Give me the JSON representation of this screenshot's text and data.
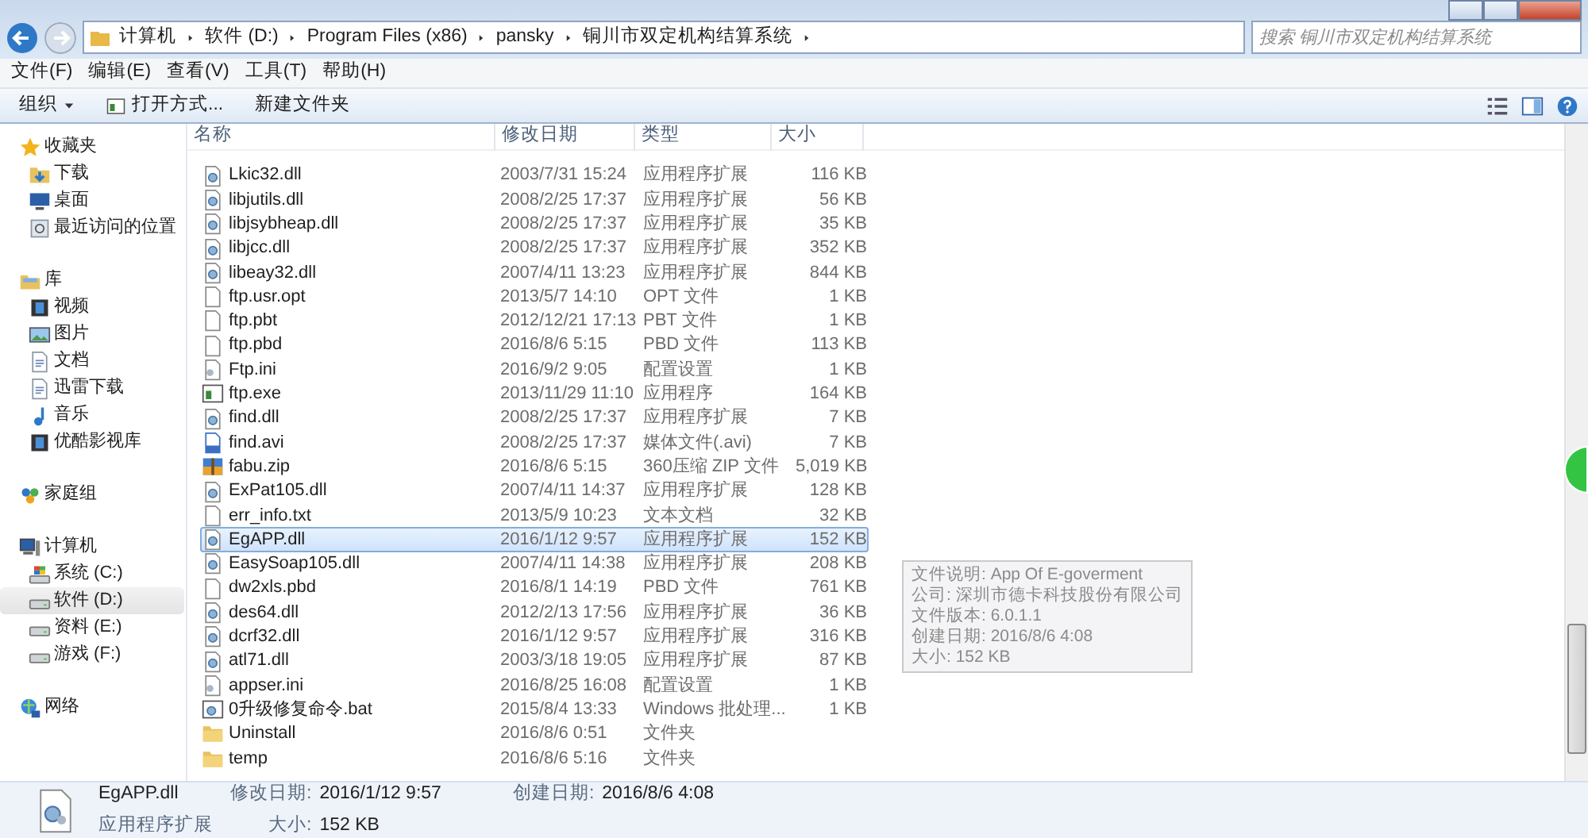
{
  "address": {
    "breadcrumb": [
      "计算机",
      "软件 (D:)",
      "Program Files (x86)",
      "pansky",
      "铜川市双定机构结算系统"
    ],
    "search": {
      "placeholder": "搜索 铜川市双定机构结算系统"
    }
  },
  "menu": [
    "文件(F)",
    "编辑(E)",
    "查看(V)",
    "工具(T)",
    "帮助(H)"
  ],
  "toolbar": [
    {
      "label": "组织",
      "kind": "menu"
    },
    {
      "label": "打开方式...",
      "kind": "open"
    },
    {
      "label": "新建文件夹",
      "kind": "plain"
    }
  ],
  "sidebar": [
    {
      "label": "收藏夹",
      "kind": "star",
      "selected": false,
      "children": [
        {
          "label": "下载",
          "kind": "download",
          "selected": false
        },
        {
          "label": "桌面",
          "kind": "desktop",
          "selected": false
        },
        {
          "label": "最近访问的位置",
          "kind": "recent",
          "selected": false
        }
      ]
    },
    {
      "label": "库",
      "kind": "library",
      "selected": false,
      "children": [
        {
          "label": "视频",
          "kind": "video",
          "selected": false
        },
        {
          "label": "图片",
          "kind": "image",
          "selected": false
        },
        {
          "label": "文档",
          "kind": "doc",
          "selected": false
        },
        {
          "label": "迅雷下载",
          "kind": "doc",
          "selected": false
        },
        {
          "label": "音乐",
          "kind": "music",
          "selected": false
        },
        {
          "label": "优酷影视库",
          "kind": "video",
          "selected": false
        }
      ]
    },
    {
      "label": "家庭组",
      "kind": "homegroup",
      "selected": false
    },
    {
      "label": "计算机",
      "kind": "computer",
      "selected": false,
      "children": [
        {
          "label": "系统 (C:)",
          "kind": "windrive",
          "selected": false
        },
        {
          "label": "软件 (D:)",
          "kind": "drive",
          "selected": true
        },
        {
          "label": "资料 (E:)",
          "kind": "drive",
          "selected": false
        },
        {
          "label": "游戏 (F:)",
          "kind": "drive",
          "selected": false
        }
      ]
    },
    {
      "label": "网络",
      "kind": "network",
      "selected": false
    }
  ],
  "columns": [
    "名称",
    "修改日期",
    "类型",
    "大小"
  ],
  "rows": [
    {
      "name": "Lkic32.dll",
      "date": "2003/7/31 15:24",
      "type": "应用程序扩展",
      "size": "116 KB",
      "kind": "dll",
      "selected": false
    },
    {
      "name": "libjutils.dll",
      "date": "2008/2/25 17:37",
      "type": "应用程序扩展",
      "size": "56 KB",
      "kind": "dll",
      "selected": false
    },
    {
      "name": "libjsybheap.dll",
      "date": "2008/2/25 17:37",
      "type": "应用程序扩展",
      "size": "35 KB",
      "kind": "dll",
      "selected": false
    },
    {
      "name": "libjcc.dll",
      "date": "2008/2/25 17:37",
      "type": "应用程序扩展",
      "size": "352 KB",
      "kind": "dll",
      "selected": false
    },
    {
      "name": "libeay32.dll",
      "date": "2007/4/11 13:23",
      "type": "应用程序扩展",
      "size": "844 KB",
      "kind": "dll",
      "selected": false
    },
    {
      "name": "ftp.usr.opt",
      "date": "2013/5/7 14:10",
      "type": "OPT 文件",
      "size": "1 KB",
      "kind": "blank",
      "selected": false
    },
    {
      "name": "ftp.pbt",
      "date": "2012/12/21 17:13",
      "type": "PBT 文件",
      "size": "1 KB",
      "kind": "blank",
      "selected": false
    },
    {
      "name": "ftp.pbd",
      "date": "2016/8/6 5:15",
      "type": "PBD 文件",
      "size": "113 KB",
      "kind": "blank",
      "selected": false
    },
    {
      "name": "Ftp.ini",
      "date": "2016/9/2 9:05",
      "type": "配置设置",
      "size": "1 KB",
      "kind": "ini",
      "selected": false
    },
    {
      "name": "ftp.exe",
      "date": "2013/11/29 11:10",
      "type": "应用程序",
      "size": "164 KB",
      "kind": "exe",
      "selected": false
    },
    {
      "name": "find.dll",
      "date": "2008/2/25 17:37",
      "type": "应用程序扩展",
      "size": "7 KB",
      "kind": "dll",
      "selected": false
    },
    {
      "name": "find.avi",
      "date": "2008/2/25 17:37",
      "type": "媒体文件(.avi)",
      "size": "7 KB",
      "kind": "avi",
      "selected": false
    },
    {
      "name": "fabu.zip",
      "date": "2016/8/6 5:15",
      "type": "360压缩 ZIP 文件",
      "size": "5,019 KB",
      "kind": "zip",
      "selected": false
    },
    {
      "name": "ExPat105.dll",
      "date": "2007/4/11 14:37",
      "type": "应用程序扩展",
      "size": "128 KB",
      "kind": "dll",
      "selected": false
    },
    {
      "name": "err_info.txt",
      "date": "2013/5/9 10:23",
      "type": "文本文档",
      "size": "32 KB",
      "kind": "blank",
      "selected": false
    },
    {
      "name": "EgAPP.dll",
      "date": "2016/1/12 9:57",
      "type": "应用程序扩展",
      "size": "152 KB",
      "kind": "dll",
      "selected": true
    },
    {
      "name": "EasySoap105.dll",
      "date": "2007/4/11 14:38",
      "type": "应用程序扩展",
      "size": "208 KB",
      "kind": "dll",
      "selected": false
    },
    {
      "name": "dw2xls.pbd",
      "date": "2016/8/1 14:19",
      "type": "PBD 文件",
      "size": "761 KB",
      "kind": "blank",
      "selected": false
    },
    {
      "name": "des64.dll",
      "date": "2012/2/13 17:56",
      "type": "应用程序扩展",
      "size": "36 KB",
      "kind": "dll",
      "selected": false
    },
    {
      "name": "dcrf32.dll",
      "date": "2016/1/12 9:57",
      "type": "应用程序扩展",
      "size": "316 KB",
      "kind": "dll",
      "selected": false
    },
    {
      "name": "atl71.dll",
      "date": "2003/3/18 19:05",
      "type": "应用程序扩展",
      "size": "87 KB",
      "kind": "dll",
      "selected": false
    },
    {
      "name": "appser.ini",
      "date": "2016/8/25 16:08",
      "type": "配置设置",
      "size": "1 KB",
      "kind": "ini",
      "selected": false
    },
    {
      "name": "0升级修复命令.bat",
      "date": "2015/8/4 13:33",
      "type": "Windows 批处理...",
      "size": "1 KB",
      "kind": "bat",
      "selected": false
    },
    {
      "name": "Uninstall",
      "date": "2016/8/6 0:51",
      "type": "文件夹",
      "kind": "folder",
      "selected": false
    },
    {
      "name": "temp",
      "date": "2016/8/6 5:16",
      "type": "文件夹",
      "kind": "folder",
      "selected": false
    }
  ],
  "tooltip": {
    "lines": [
      "文件说明: App Of E-goverment",
      "公司: 深圳市德卡科技股份有限公司",
      "文件版本: 6.0.1.1",
      "创建日期: 2016/8/6 4:08",
      "大小: 152 KB"
    ]
  },
  "status": {
    "name": "EgAPP.dll",
    "type": "应用程序扩展",
    "modified_label": "修改日期:",
    "modified": "2016/1/12 9:57",
    "created_label": "创建日期:",
    "created": "2016/8/6 4:08",
    "size_label": "大小:",
    "size": "152 KB"
  }
}
